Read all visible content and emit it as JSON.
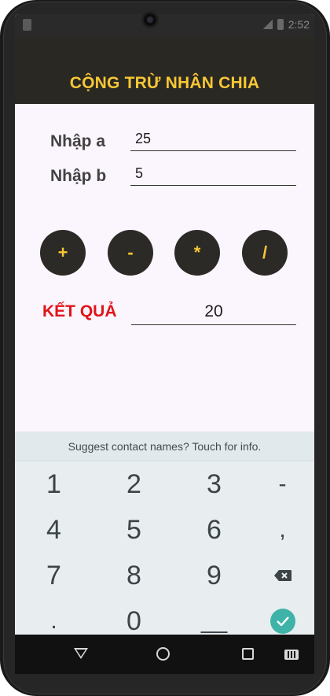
{
  "app": {
    "title": "CỘNG TRỪ NHÂN CHIA"
  },
  "status": {
    "time": "2:52"
  },
  "form": {
    "a_label": "Nhập a",
    "a_value": "25",
    "b_label": "Nhập b",
    "b_value": "5"
  },
  "operators": {
    "add": "+",
    "sub": "-",
    "mul": "*",
    "div": "/"
  },
  "result": {
    "label": "KẾT QUẢ",
    "value": "20"
  },
  "keyboard": {
    "suggestion": "Suggest contact names? Touch for info.",
    "row1": [
      "1",
      "2",
      "3",
      "-"
    ],
    "row2": [
      "4",
      "5",
      "6",
      ","
    ],
    "row3": [
      "7",
      "8",
      "9"
    ],
    "row4": [
      ".",
      "0",
      "__"
    ]
  },
  "colors": {
    "accent": "#f7c735",
    "result_label": "#e0141a",
    "enter_key": "#3fb3a8"
  }
}
